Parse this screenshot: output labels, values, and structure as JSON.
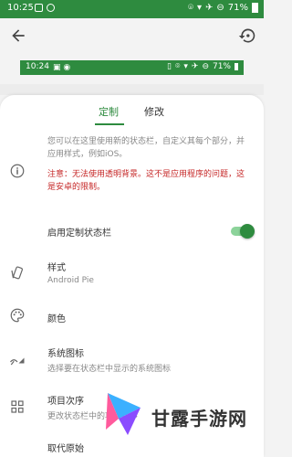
{
  "status_bar": {
    "time": "10:25",
    "battery": "71%"
  },
  "preview_bar": {
    "time": "10:24",
    "battery": "71%"
  },
  "tabs": [
    {
      "label": "定制"
    },
    {
      "label": "修改"
    }
  ],
  "info": {
    "text": "您可以在这里使用新的状态栏，自定义其每个部分，并应用样式，例如iOS。",
    "warning": "注意：无法使用透明背景。这不是应用程序的问题，这是安卓的限制。"
  },
  "enable_row": {
    "label": "启用定制状态栏",
    "enabled": true
  },
  "style_row": {
    "label": "样式",
    "value": "Android Pie"
  },
  "color_row": {
    "label": "颜色"
  },
  "system_icons_row": {
    "label": "系统图标",
    "description": "选择要在状态栏中显示的系统图标"
  },
  "item_order_row": {
    "label": "项目次序",
    "description": "更改状态栏中的项目次序"
  },
  "last_row": {
    "label": "取代原始"
  },
  "watermark": {
    "text": "甘露手游网"
  }
}
